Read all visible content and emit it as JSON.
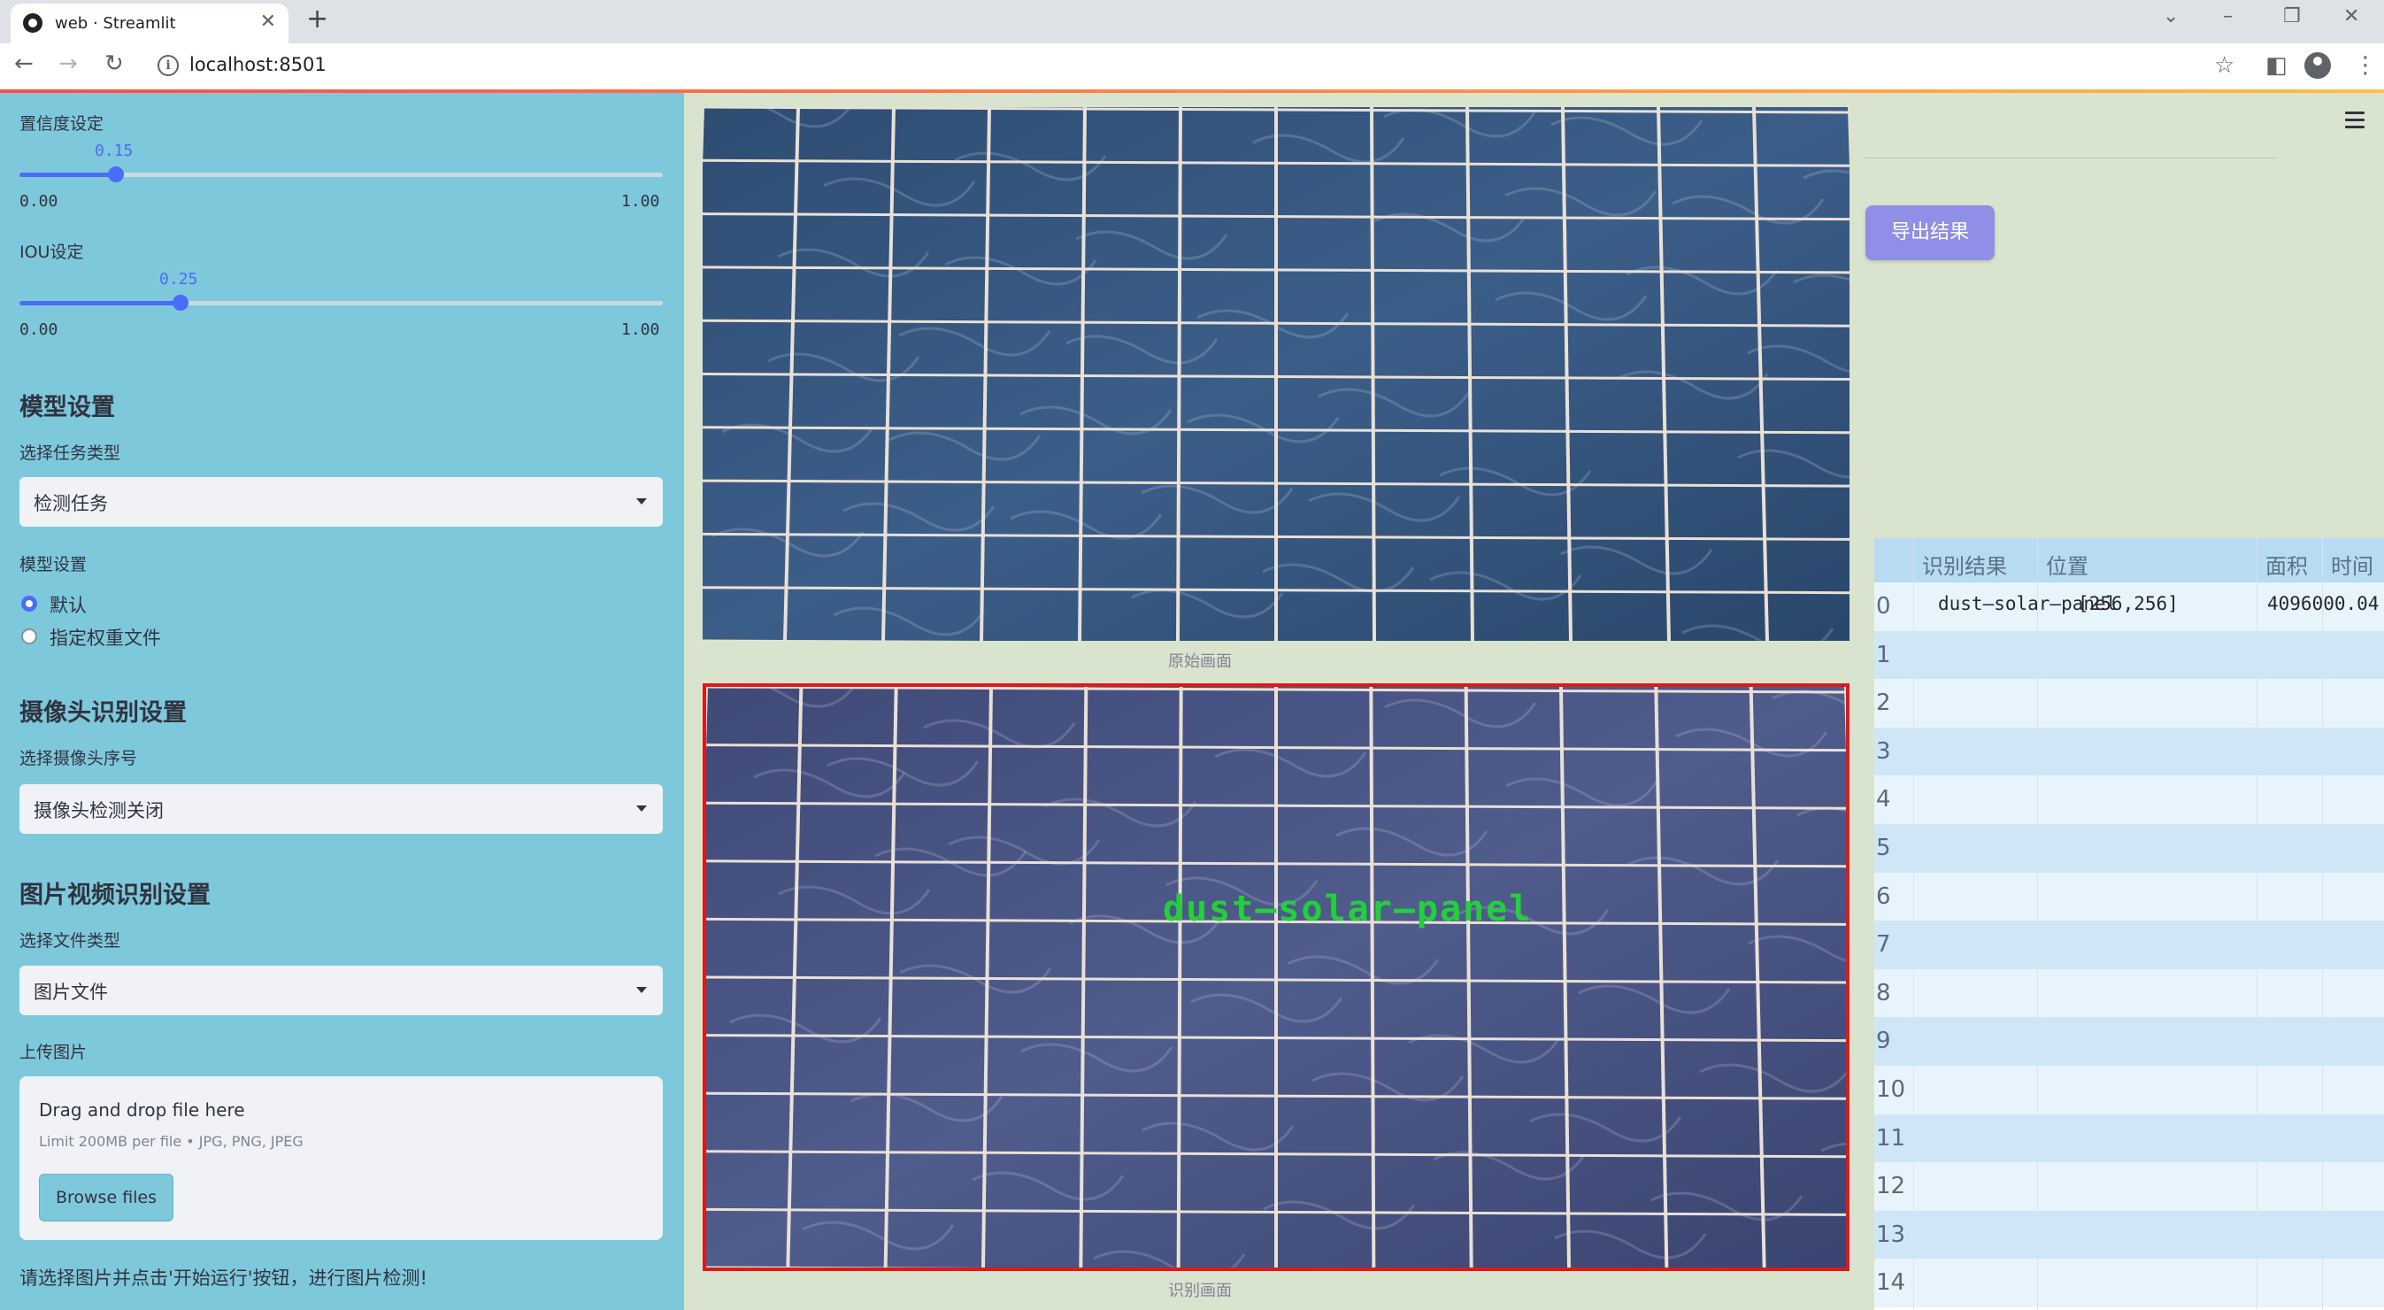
{
  "browser": {
    "tab_title": "web · Streamlit",
    "new_tab": "+",
    "url": "localhost:8501"
  },
  "sidebar": {
    "confidence": {
      "label": "置信度设定",
      "value": "0.15",
      "value_fraction": 0.15,
      "min": "0.00",
      "max": "1.00"
    },
    "iou": {
      "label": "IOU设定",
      "value": "0.25",
      "value_fraction": 0.25,
      "min": "0.00",
      "max": "1.00"
    },
    "model_section": {
      "title": "模型设置",
      "task_label": "选择任务类型",
      "task_value": "检测任务",
      "model_label": "模型设置",
      "radio_options": [
        "默认",
        "指定权重文件"
      ],
      "radio_selected": 0
    },
    "camera_section": {
      "title": "摄像头识别设置",
      "camera_label": "选择摄像头序号",
      "camera_value": "摄像头检测关闭"
    },
    "file_section": {
      "title": "图片视频识别设置",
      "type_label": "选择文件类型",
      "type_value": "图片文件",
      "upload_label": "上传图片",
      "drop_text": "Drag and drop file here",
      "limit_text": "Limit 200MB per file • JPG, PNG, JPEG",
      "browse_label": "Browse files"
    },
    "note": "请选择图片并点击'开始运行'按钮，进行图片检测!"
  },
  "main": {
    "original_caption": "原始画面",
    "detected_caption": "识别画面",
    "detection_label": "dust—solar—panel"
  },
  "right": {
    "export_label": "导出结果",
    "table": {
      "columns": [
        "识别结果",
        "位置",
        "面积",
        "时间"
      ],
      "rows": [
        {
          "index": "0",
          "result": "dust—solar—panel",
          "position": "[256,256]",
          "area": "4096000.04"
        },
        {
          "index": "1"
        },
        {
          "index": "2"
        },
        {
          "index": "3"
        },
        {
          "index": "4"
        },
        {
          "index": "5"
        },
        {
          "index": "6"
        },
        {
          "index": "7"
        },
        {
          "index": "8"
        },
        {
          "index": "9"
        },
        {
          "index": "10"
        },
        {
          "index": "11"
        },
        {
          "index": "12"
        },
        {
          "index": "13"
        },
        {
          "index": "14"
        }
      ]
    }
  },
  "colors": {
    "sidebar_bg": "#7ec8dc",
    "accent": "#4a6cf7",
    "export_button": "#8f8fe8",
    "detection_box": "#e01818",
    "detection_text": "#22d13a"
  }
}
